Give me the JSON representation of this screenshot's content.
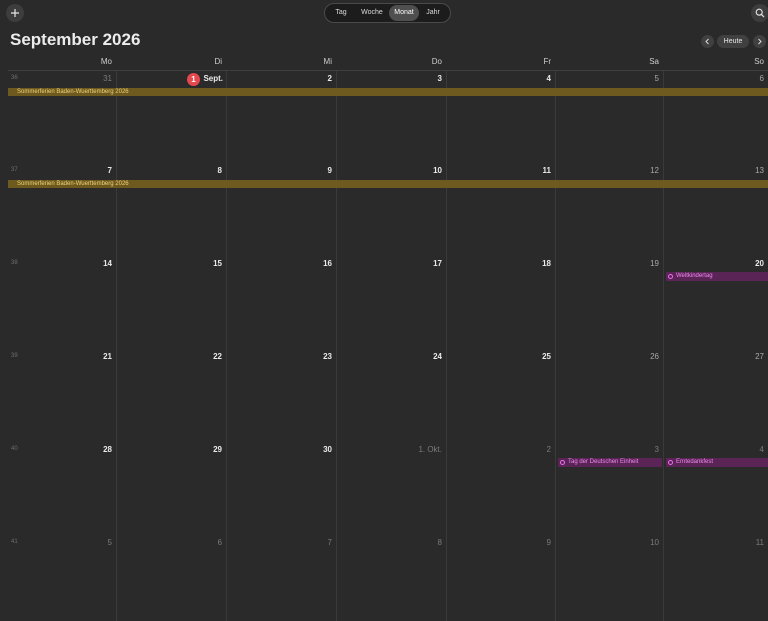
{
  "toolbar": {
    "add_icon": "plus-icon",
    "search_icon": "search-icon",
    "views": [
      "Tag",
      "Woche",
      "Monat",
      "Jahr"
    ],
    "active_view": "Monat"
  },
  "header": {
    "title": "September 2026",
    "today_label": "Heute",
    "prev_icon": "chevron-left-icon",
    "next_icon": "chevron-right-icon"
  },
  "weekdays": [
    "Mo",
    "Di",
    "Mi",
    "Do",
    "Fr",
    "Sa",
    "So"
  ],
  "weeks": [
    {
      "num": "36",
      "days": [
        "31",
        "Sept.",
        "2",
        "3",
        "4",
        "5",
        "6"
      ]
    },
    {
      "num": "37",
      "days": [
        "7",
        "8",
        "9",
        "10",
        "11",
        "12",
        "13"
      ]
    },
    {
      "num": "38",
      "days": [
        "14",
        "15",
        "16",
        "17",
        "18",
        "19",
        "20"
      ]
    },
    {
      "num": "39",
      "days": [
        "21",
        "22",
        "23",
        "24",
        "25",
        "26",
        "27"
      ]
    },
    {
      "num": "40",
      "days": [
        "28",
        "29",
        "30",
        "1. Okt.",
        "2",
        "3",
        "4"
      ]
    },
    {
      "num": "41",
      "days": [
        "5",
        "6",
        "7",
        "8",
        "9",
        "10",
        "11"
      ]
    }
  ],
  "today": {
    "badge": "1"
  },
  "events": {
    "holiday_bar_1": "Sommerferien Baden-Wuerttemberg 2026",
    "holiday_bar_2": "Sommerferien Baden-Wuerttemberg 2026",
    "weltkindertag": "Weltkindertag",
    "einheit": "Tag der Deutschen Einheit",
    "erntedank": "Erntedankfest"
  },
  "colors": {
    "background": "#2a2a2a",
    "today_accent": "#e5484d",
    "holiday_bar": "#6e5a1e",
    "holiday_text": "#f0d27a",
    "event_bg": "#5a2456",
    "event_text": "#f08af0"
  }
}
